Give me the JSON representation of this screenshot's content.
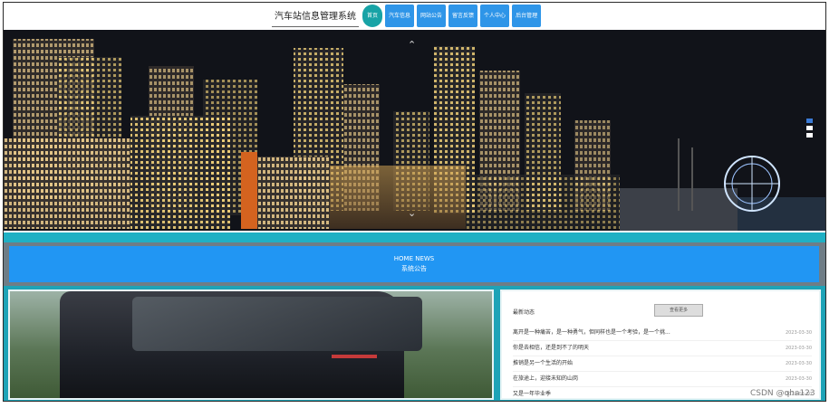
{
  "header": {
    "site_title": "汽车站信息管理系统",
    "nav": [
      {
        "label": "首页",
        "active": true
      },
      {
        "label": "汽车信息",
        "active": false
      },
      {
        "label": "网站公告",
        "active": false
      },
      {
        "label": "留言反馈",
        "active": false
      },
      {
        "label": "个人中心",
        "active": false
      },
      {
        "label": "后台管理",
        "active": false
      }
    ]
  },
  "banner": {
    "up_icon": "chevron-up-icon",
    "down_icon": "chevron-down-icon",
    "slides": 2,
    "active_slide": 1
  },
  "news_section": {
    "title_en": "HOME NEWS",
    "title_cn": "系统公告"
  },
  "news_panel": {
    "title": "最新动态",
    "more_label": "查看更多",
    "items": [
      {
        "title": "离开是一种痛苦，是一种勇气，但同样也是一个考验，是一个挑...",
        "date": "2023-03-30"
      },
      {
        "title": "你是去相信，还是到不了的明天",
        "date": "2023-03-30"
      },
      {
        "title": "推销是另一个生活的开始",
        "date": "2023-03-30"
      },
      {
        "title": "在旅途上，迎接未知的山岗",
        "date": "2023-03-30"
      },
      {
        "title": "又是一年毕业季",
        "date": "2023-03-30"
      }
    ]
  },
  "watermark": "CSDN @qha123",
  "colors": {
    "nav_blue": "#2e95e8",
    "nav_active": "#17a3a6",
    "teal": "#1fb0c4",
    "news_blue": "#2196f3"
  }
}
